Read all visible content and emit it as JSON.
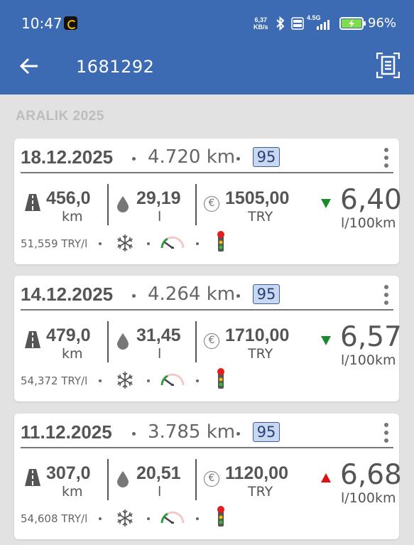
{
  "status_bar": {
    "time": "10:47",
    "net_speed_value": "6,37",
    "net_speed_unit": "KB/s",
    "network_type": "4.5G",
    "battery_percent": "96%",
    "icons": [
      "app-notification-icon",
      "bluetooth-icon",
      "volte-icon",
      "signal-icon",
      "battery-charging-icon"
    ]
  },
  "app_bar": {
    "title": "1681292",
    "back_icon": "arrow-left-icon",
    "action_icon": "scan-document-icon"
  },
  "section": {
    "label": "ARALIK 2025"
  },
  "colors": {
    "header": "#3d6bb3",
    "background": "#e2e2e2",
    "badge_fill": "#c8d8f0",
    "trend_down": "#1a8a2a",
    "trend_up": "#dd1111"
  },
  "entries": [
    {
      "date": "18.12.2025",
      "odometer": "4.720 km",
      "fuel_grade": "95",
      "distance": "456,0",
      "distance_unit": "km",
      "liters": "29,19",
      "liters_unit": "l",
      "cost": "1505,00",
      "currency": "TRY",
      "consumption": "6,40",
      "consumption_unit": "l/100km",
      "trend": "down",
      "price_per_liter": "51,559 TRY/l",
      "conditions": [
        "snowflake-icon",
        "gauge-icon",
        "traffic-light-icon"
      ]
    },
    {
      "date": "14.12.2025",
      "odometer": "4.264 km",
      "fuel_grade": "95",
      "distance": "479,0",
      "distance_unit": "km",
      "liters": "31,45",
      "liters_unit": "l",
      "cost": "1710,00",
      "currency": "TRY",
      "consumption": "6,57",
      "consumption_unit": "l/100km",
      "trend": "down",
      "price_per_liter": "54,372 TRY/l",
      "conditions": [
        "snowflake-icon",
        "gauge-icon",
        "traffic-light-icon"
      ]
    },
    {
      "date": "11.12.2025",
      "odometer": "3.785 km",
      "fuel_grade": "95",
      "distance": "307,0",
      "distance_unit": "km",
      "liters": "20,51",
      "liters_unit": "l",
      "cost": "1120,00",
      "currency": "TRY",
      "consumption": "6,68",
      "consumption_unit": "l/100km",
      "trend": "up",
      "price_per_liter": "54,608 TRY/l",
      "conditions": [
        "snowflake-icon",
        "gauge-icon",
        "traffic-light-icon"
      ]
    }
  ]
}
